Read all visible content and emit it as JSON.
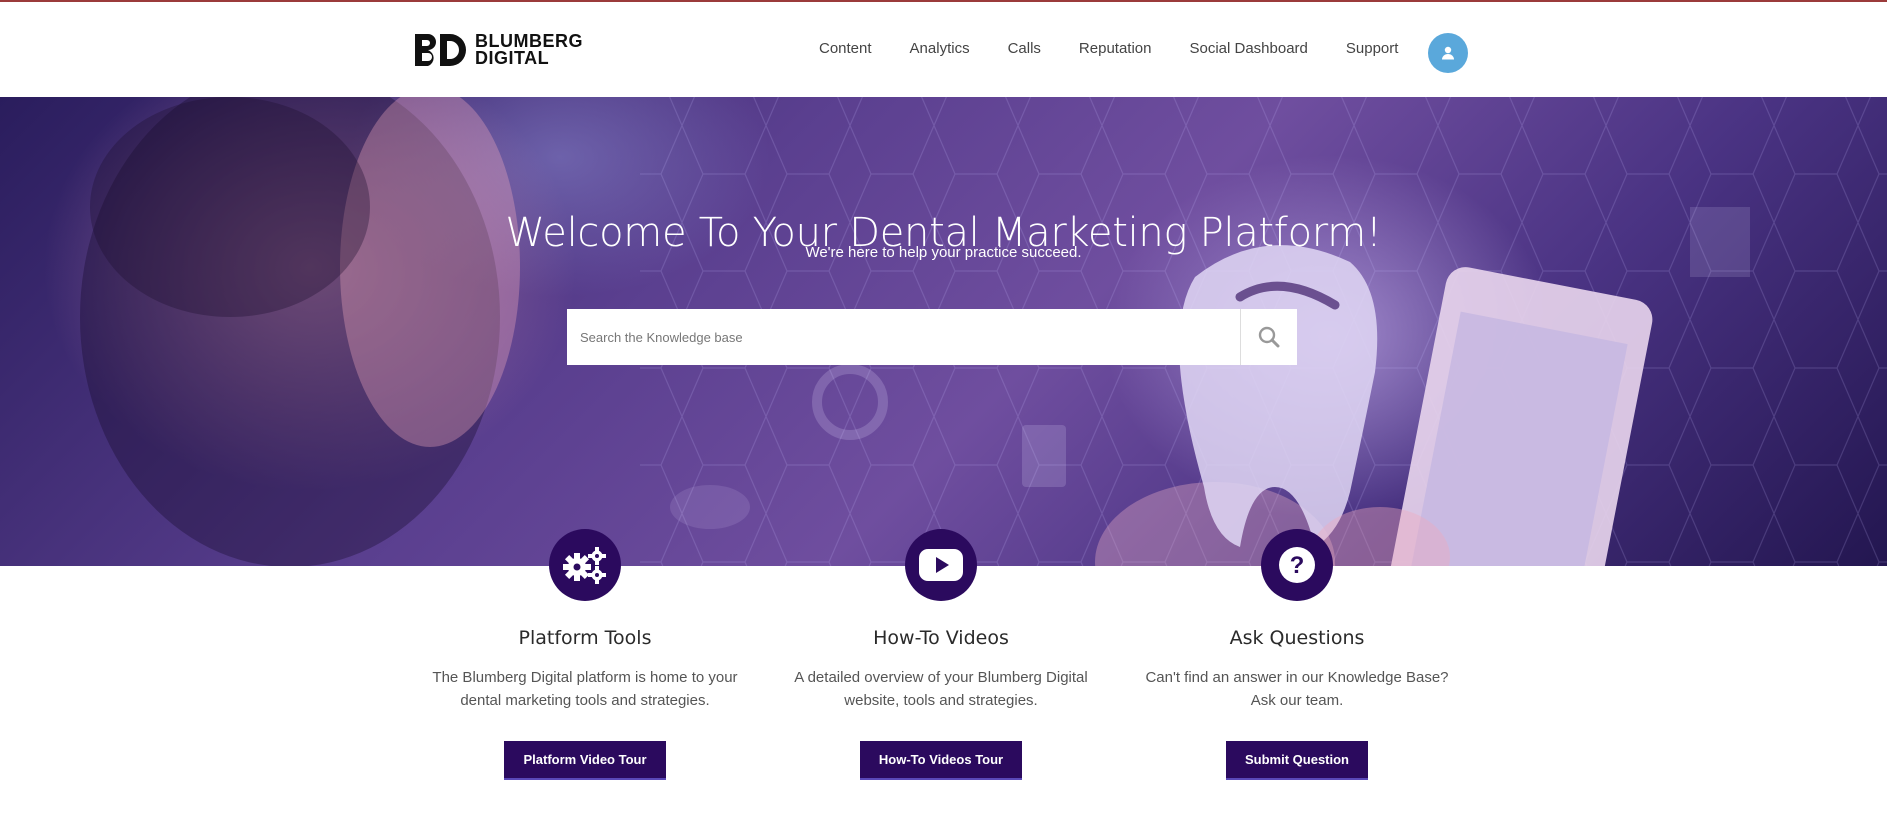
{
  "brand": {
    "name_line1": "BLUMBERG",
    "name_line2": "DIGITAL",
    "logo_mark": "BD-logo-mark"
  },
  "nav": {
    "items": [
      {
        "label": "Content"
      },
      {
        "label": "Analytics"
      },
      {
        "label": "Calls"
      },
      {
        "label": "Reputation"
      },
      {
        "label": "Social Dashboard"
      },
      {
        "label": "Support"
      }
    ],
    "avatar_icon": "user-icon"
  },
  "hero": {
    "title": "Welcome To Your Dental Marketing Platform!",
    "subtitle": "We're here to help your practice succeed.",
    "search_placeholder": "Search the Knowledge base",
    "search_icon": "search-icon"
  },
  "cards": [
    {
      "icon": "gears-icon",
      "title": "Platform Tools",
      "text": "The Blumberg Digital platform is home to your dental marketing tools and strategies.",
      "button": "Platform Video Tour"
    },
    {
      "icon": "play-video-icon",
      "title": "How-To Videos",
      "text": "A detailed overview of your Blumberg Digital website, tools and strategies.",
      "button": "How-To Videos Tour"
    },
    {
      "icon": "question-icon",
      "title": "Ask Questions",
      "text": "Can't find an answer in our Knowledge Base? Ask our team.",
      "button": "Submit Question"
    }
  ],
  "colors": {
    "accent": "#2b0a5e",
    "avatar": "#5aa8db",
    "topline": "#9b3b3b"
  }
}
